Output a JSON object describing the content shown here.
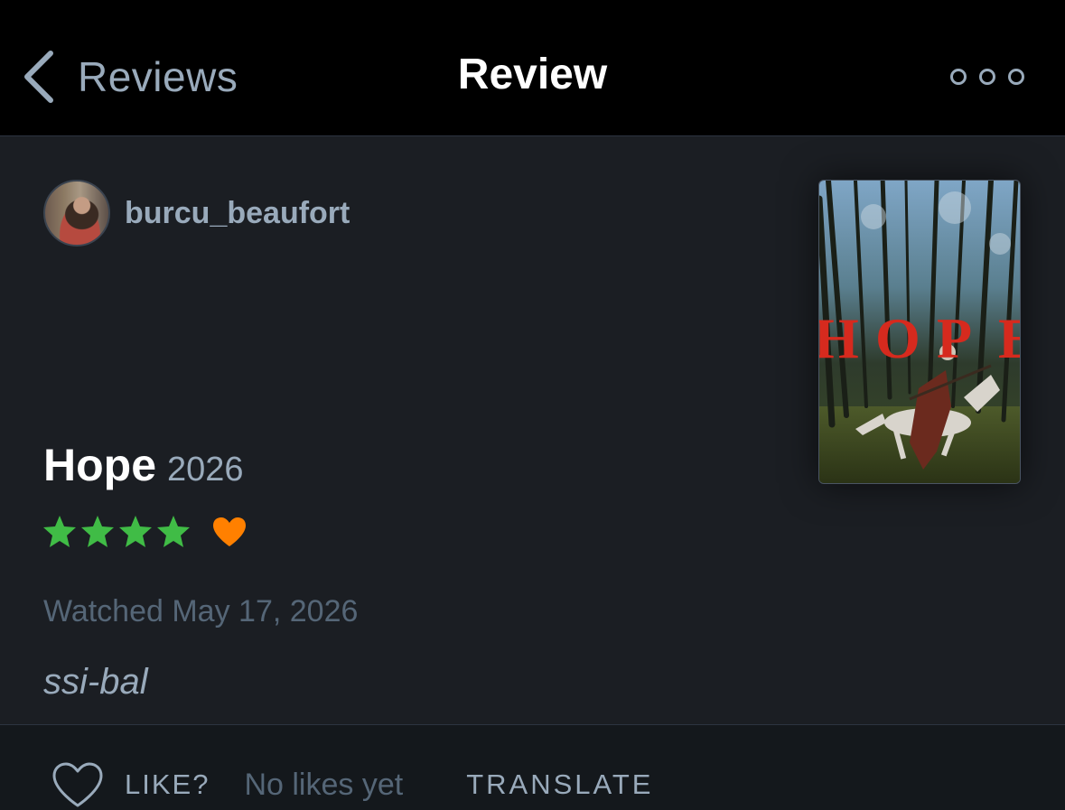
{
  "navbar": {
    "back_label": "Reviews",
    "title": "Review",
    "back_icon": "chevron-left-icon",
    "more_icon": "more-options-icon"
  },
  "review": {
    "username": "burcu_beaufort",
    "film_title": "Hope",
    "film_year": "2026",
    "rating_stars": 4,
    "liked": true,
    "watched_text": "Watched May 17, 2026",
    "body": "ssi-bal",
    "poster_lettering": "HOPE"
  },
  "actions": {
    "like_label": "LIKE?",
    "likes_status": "No likes yet",
    "translate_label": "TRANSLATE"
  },
  "colors": {
    "star": "#40bc46",
    "heart": "#ff8000",
    "muted": "#99aabb",
    "dim": "#556677",
    "background": "#1b1e23",
    "navbar": "#000000"
  }
}
